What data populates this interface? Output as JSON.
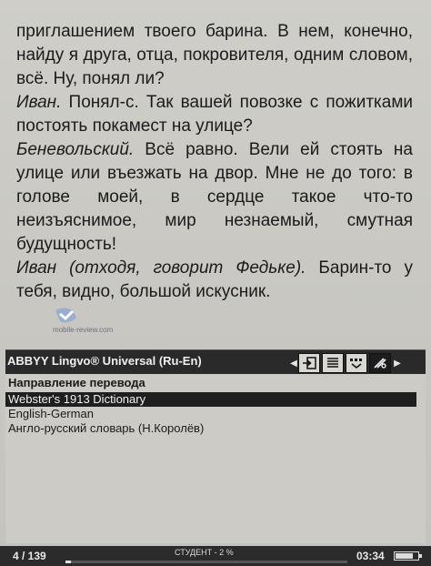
{
  "reader": {
    "paragraphs": [
      {
        "speaker": "",
        "text": "приглашением твоего барина. В нем, конечно, найду я друга, отца, покровителя, одним словом, всё. Ну, понял ли?"
      },
      {
        "speaker": "Иван.",
        "text": " Понял-с. Так вашей повозке с пожитками постоять покамест на улице?"
      },
      {
        "speaker": "Беневольский.",
        "text": " Всё равно. Вели ей стоять на улице или въезжать на двор. Мне не до того: в голове моей, в сердце такое что-то неизъяснимое, мир незнаемый, смутная будущность!"
      },
      {
        "speaker": "Иван (отходя, говорит Федьке).",
        "text": " Барин-то у тебя, видно, большой искусник."
      }
    ],
    "watermark": "mobile-review.com"
  },
  "lingvo": {
    "title": "ABBYY Lingvo® Universal (Ru-En)",
    "toolbar": {
      "icons": [
        "chevron-left-icon",
        "exit-icon",
        "list-icon",
        "keyboard-icon",
        "settings-tools-icon",
        "chevron-right-icon"
      ]
    },
    "section_label": "Направление перевода",
    "dictionaries": [
      {
        "label": "Webster's 1913 Dictionary",
        "selected": true
      },
      {
        "label": "English-German",
        "selected": false
      },
      {
        "label": "Англо-русский словарь (Н.Королёв)",
        "selected": false
      }
    ]
  },
  "status": {
    "pages": "4 / 139",
    "book": "СТУДЕНТ - 2 %",
    "progress_percent": 2,
    "time": "03:34",
    "battery_fraction": 0.8
  }
}
